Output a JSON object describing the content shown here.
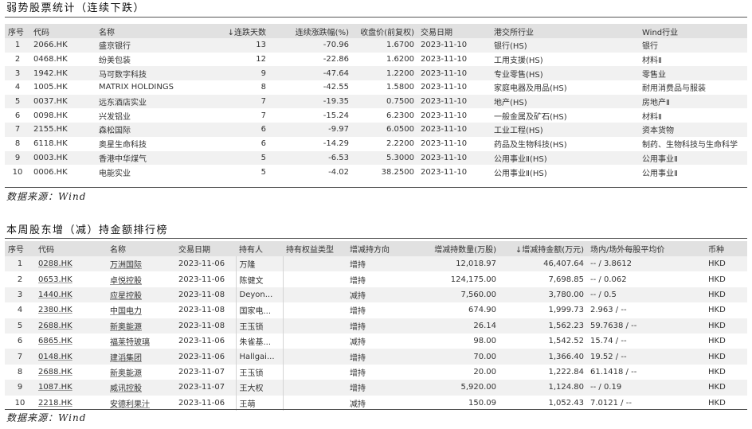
{
  "section1": {
    "title": "弱势股票统计（连续下跌）",
    "headers": [
      "序号",
      "代码",
      "名称",
      "↓连跌天数",
      "连续涨跌幅(%)",
      "收盘价(前复权)",
      "交易日期",
      "港交所行业",
      "Wind行业"
    ],
    "rows": [
      [
        "1",
        "2066.HK",
        "盛京银行",
        "13",
        "-70.96",
        "1.6700",
        "2023-11-10",
        "银行(HS)",
        "银行"
      ],
      [
        "2",
        "0468.HK",
        "纷美包装",
        "12",
        "-22.86",
        "1.6200",
        "2023-11-10",
        "工用支援(HS)",
        "材料Ⅱ"
      ],
      [
        "3",
        "1942.HK",
        "马可数字科技",
        "9",
        "-47.64",
        "1.2200",
        "2023-11-10",
        "专业零售(HS)",
        "零售业"
      ],
      [
        "4",
        "1005.HK",
        "MATRIX HOLDINGS",
        "8",
        "-42.55",
        "1.5800",
        "2023-11-10",
        "家庭电器及用品(HS)",
        "耐用消费品与服装"
      ],
      [
        "5",
        "0037.HK",
        "远东酒店实业",
        "7",
        "-19.35",
        "0.7500",
        "2023-11-10",
        "地产(HS)",
        "房地产Ⅱ"
      ],
      [
        "6",
        "0098.HK",
        "兴发铝业",
        "7",
        "-15.24",
        "6.2300",
        "2023-11-10",
        "一般金属及矿石(HS)",
        "材料Ⅱ"
      ],
      [
        "7",
        "2155.HK",
        "森松国际",
        "6",
        "-9.97",
        "6.0500",
        "2023-11-10",
        "工业工程(HS)",
        "资本货物"
      ],
      [
        "8",
        "6118.HK",
        "奥星生命科技",
        "6",
        "-14.29",
        "2.2200",
        "2023-11-10",
        "药品及生物科技(HS)",
        "制药、生物科技与生命科学"
      ],
      [
        "9",
        "0003.HK",
        "香港中华煤气",
        "5",
        "-6.53",
        "5.3000",
        "2023-11-10",
        "公用事业Ⅱ(HS)",
        "公用事业Ⅱ"
      ],
      [
        "10",
        "0006.HK",
        "电能实业",
        "5",
        "-4.02",
        "38.2500",
        "2023-11-10",
        "公用事业Ⅱ(HS)",
        "公用事业Ⅱ"
      ]
    ],
    "source": "数据来源：Wind"
  },
  "section2": {
    "title": "本周股东增（减）持金额排行榜",
    "headers": [
      "序号",
      "代码",
      "名称",
      "交易日期",
      "持有人",
      "持有权益类型",
      "增减持方向",
      "增减持数量(万股)",
      "↓增减持金额(万元)",
      "场内/场外每股平均价",
      "币种"
    ],
    "rows": [
      [
        "1",
        "0288.HK",
        "万洲国际",
        "2023-11-06",
        "万隆",
        "",
        "增持",
        "12,018.97",
        "46,407.64",
        "-- / 3.8612",
        "HKD"
      ],
      [
        "2",
        "0653.HK",
        "卓悦控股",
        "2023-11-06",
        "陈健文",
        "",
        "增持",
        "124,175.00",
        "7,698.85",
        "-- / 0.062",
        "HKD"
      ],
      [
        "3",
        "1440.HK",
        "应星控股",
        "2023-11-08",
        "Deyon...",
        "",
        "减持",
        "7,560.00",
        "3,780.00",
        "-- / 0.5",
        "HKD"
      ],
      [
        "4",
        "2380.HK",
        "中国电力",
        "2023-11-08",
        "国家电...",
        "",
        "增持",
        "674.90",
        "1,999.73",
        "2.963 / --",
        "HKD"
      ],
      [
        "5",
        "2688.HK",
        "新奥能源",
        "2023-11-08",
        "王玉锁",
        "",
        "增持",
        "26.14",
        "1,562.23",
        "59.7638 / --",
        "HKD"
      ],
      [
        "6",
        "6865.HK",
        "福莱特玻璃",
        "2023-11-06",
        "朱雀基...",
        "",
        "减持",
        "98.00",
        "1,542.52",
        "15.74 / --",
        "HKD"
      ],
      [
        "7",
        "0148.HK",
        "建滔集团",
        "2023-11-06",
        "Hallgai...",
        "",
        "增持",
        "70.00",
        "1,366.40",
        "19.52 / --",
        "HKD"
      ],
      [
        "8",
        "2688.HK",
        "新奥能源",
        "2023-11-07",
        "王玉锁",
        "",
        "增持",
        "20.00",
        "1,222.84",
        "61.1418 / --",
        "HKD"
      ],
      [
        "9",
        "1087.HK",
        "威讯控股",
        "2023-11-07",
        "王大权",
        "",
        "增持",
        "5,920.00",
        "1,124.80",
        "-- / 0.19",
        "HKD"
      ],
      [
        "10",
        "2218.HK",
        "安德利果汁",
        "2023-11-06",
        "王萌",
        "",
        "减持",
        "150.09",
        "1,052.43",
        "7.0121 / --",
        "HKD"
      ]
    ],
    "source": "数据来源：Wind"
  }
}
